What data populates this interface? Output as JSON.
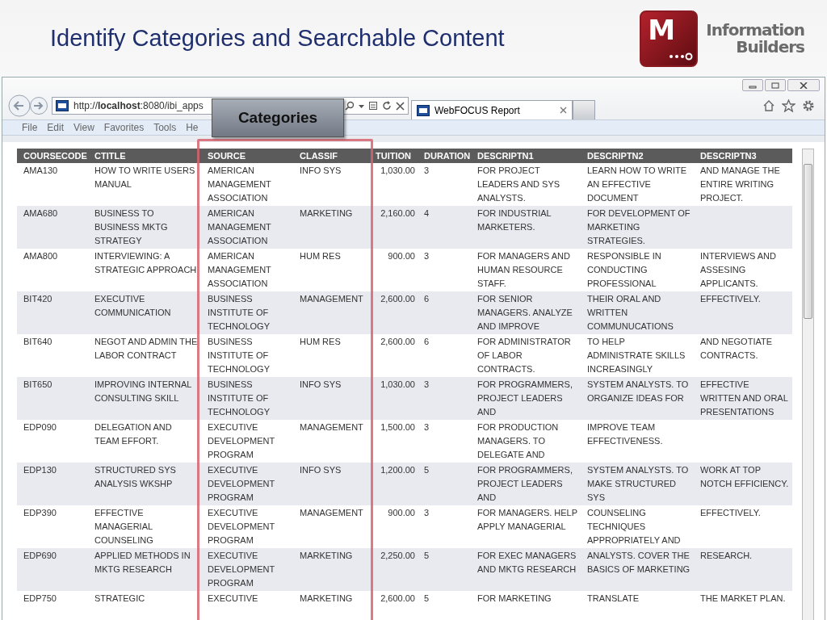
{
  "slide": {
    "title": "Identify Categories and Searchable Content"
  },
  "logo": {
    "letter": "M",
    "company": [
      "Information",
      "Builders"
    ]
  },
  "browser": {
    "address": "http://**localhost**:8080/ibi_apps",
    "tab": {
      "label": "WebFOCUS Report",
      "selected": true
    },
    "menu": [
      "File",
      "Edit",
      "View",
      "Favorites",
      "Tools",
      "He"
    ]
  },
  "callout": {
    "label": "Categories"
  },
  "table": {
    "columns": [
      "COURSECODE",
      "CTITLE",
      "SOURCE",
      "CLASSIF",
      "TUITION",
      "DURATION",
      "DESCRIPTN1",
      "DESCRIPTN2",
      "DESCRIPTN3"
    ],
    "rows": [
      [
        "AMA130",
        "HOW TO WRITE USERS MANUAL",
        "AMERICAN MANAGEMENT ASSOCIATION",
        "INFO SYS",
        "1,030.00",
        "3",
        "FOR PROJECT LEADERS AND SYS ANALYSTS.",
        "LEARN HOW TO WRITE AN EFFECTIVE DOCUMENT",
        "AND MANAGE THE ENTIRE WRITING PROJECT."
      ],
      [
        "AMA680",
        "BUSINESS TO BUSINESS MKTG STRATEGY",
        "AMERICAN MANAGEMENT ASSOCIATION",
        "MARKETING",
        "2,160.00",
        "4",
        "FOR INDUSTRIAL MARKETERS.",
        "FOR DEVELOPMENT OF MARKETING STRATEGIES.",
        ""
      ],
      [
        "AMA800",
        "INTERVIEWING: A STRATEGIC APPROACH",
        "AMERICAN MANAGEMENT ASSOCIATION",
        "HUM RES",
        "900.00",
        "3",
        "FOR MANAGERS AND HUMAN RESOURCE STAFF.",
        "RESPONSIBLE IN CONDUCTING PROFESSIONAL",
        "INTERVIEWS AND ASSESING APPLICANTS."
      ],
      [
        "BIT420",
        "EXECUTIVE COMMUNICATION",
        "BUSINESS INSTITUTE OF TECHNOLOGY",
        "MANAGEMENT",
        "2,600.00",
        "6",
        "FOR SENIOR MANAGERS. ANALYZE AND IMPROVE",
        "THEIR ORAL AND WRITTEN COMMUNUCATIONS",
        "EFFECTIVELY."
      ],
      [
        "BIT640",
        "NEGOT AND ADMIN THE LABOR CONTRACT",
        "BUSINESS INSTITUTE OF TECHNOLOGY",
        "HUM RES",
        "2,600.00",
        "6",
        "FOR ADMINISTRATOR OF LABOR CONTRACTS.",
        "TO HELP ADMINISTRATE SKILLS INCREASINGLY",
        "AND NEGOTIATE CONTRACTS."
      ],
      [
        "BIT650",
        "IMPROVING INTERNAL CONSULTING SKILL",
        "BUSINESS INSTITUTE OF TECHNOLOGY",
        "INFO SYS",
        "1,030.00",
        "3",
        "FOR PROGRAMMERS, PROJECT LEADERS AND",
        "SYSTEM ANALYSTS. TO ORGANIZE IDEAS FOR",
        "EFFECTIVE WRITTEN AND ORAL PRESENTATIONS"
      ],
      [
        "EDP090",
        "DELEGATION AND TEAM EFFORT.",
        "EXECUTIVE DEVELOPMENT PROGRAM",
        "MANAGEMENT",
        "1,500.00",
        "3",
        "FOR PRODUCTION MANAGERS. TO DELEGATE AND",
        "IMPROVE TEAM EFFECTIVENESS.",
        ""
      ],
      [
        "EDP130",
        "STRUCTURED SYS ANALYSIS WKSHP",
        "EXECUTIVE DEVELOPMENT PROGRAM",
        "INFO SYS",
        "1,200.00",
        "5",
        "FOR PROGRAMMERS, PROJECT LEADERS AND",
        "SYSTEM ANALYSTS. TO MAKE STRUCTURED SYS",
        "WORK AT TOP NOTCH EFFICIENCY."
      ],
      [
        "EDP390",
        "EFFECTIVE MANAGERIAL COUNSELING",
        "EXECUTIVE DEVELOPMENT PROGRAM",
        "MANAGEMENT",
        "900.00",
        "3",
        "FOR MANAGERS. HELP APPLY MANAGERIAL",
        "COUNSELING TECHNIQUES APPROPRIATELY AND",
        "EFFECTIVELY."
      ],
      [
        "EDP690",
        "APPLIED METHODS IN MKTG RESEARCH",
        "EXECUTIVE DEVELOPMENT PROGRAM",
        "MARKETING",
        "2,250.00",
        "5",
        "FOR EXEC MANAGERS AND MKTG RESEARCH",
        "ANALYSTS. COVER THE BASICS OF MARKETING",
        "RESEARCH."
      ],
      [
        "EDP750",
        "STRATEGIC",
        "EXECUTIVE",
        "MARKETING",
        "2,600.00",
        "5",
        "FOR MARKETING",
        "TRANSLATE",
        "THE MARKET PLAN."
      ]
    ]
  }
}
